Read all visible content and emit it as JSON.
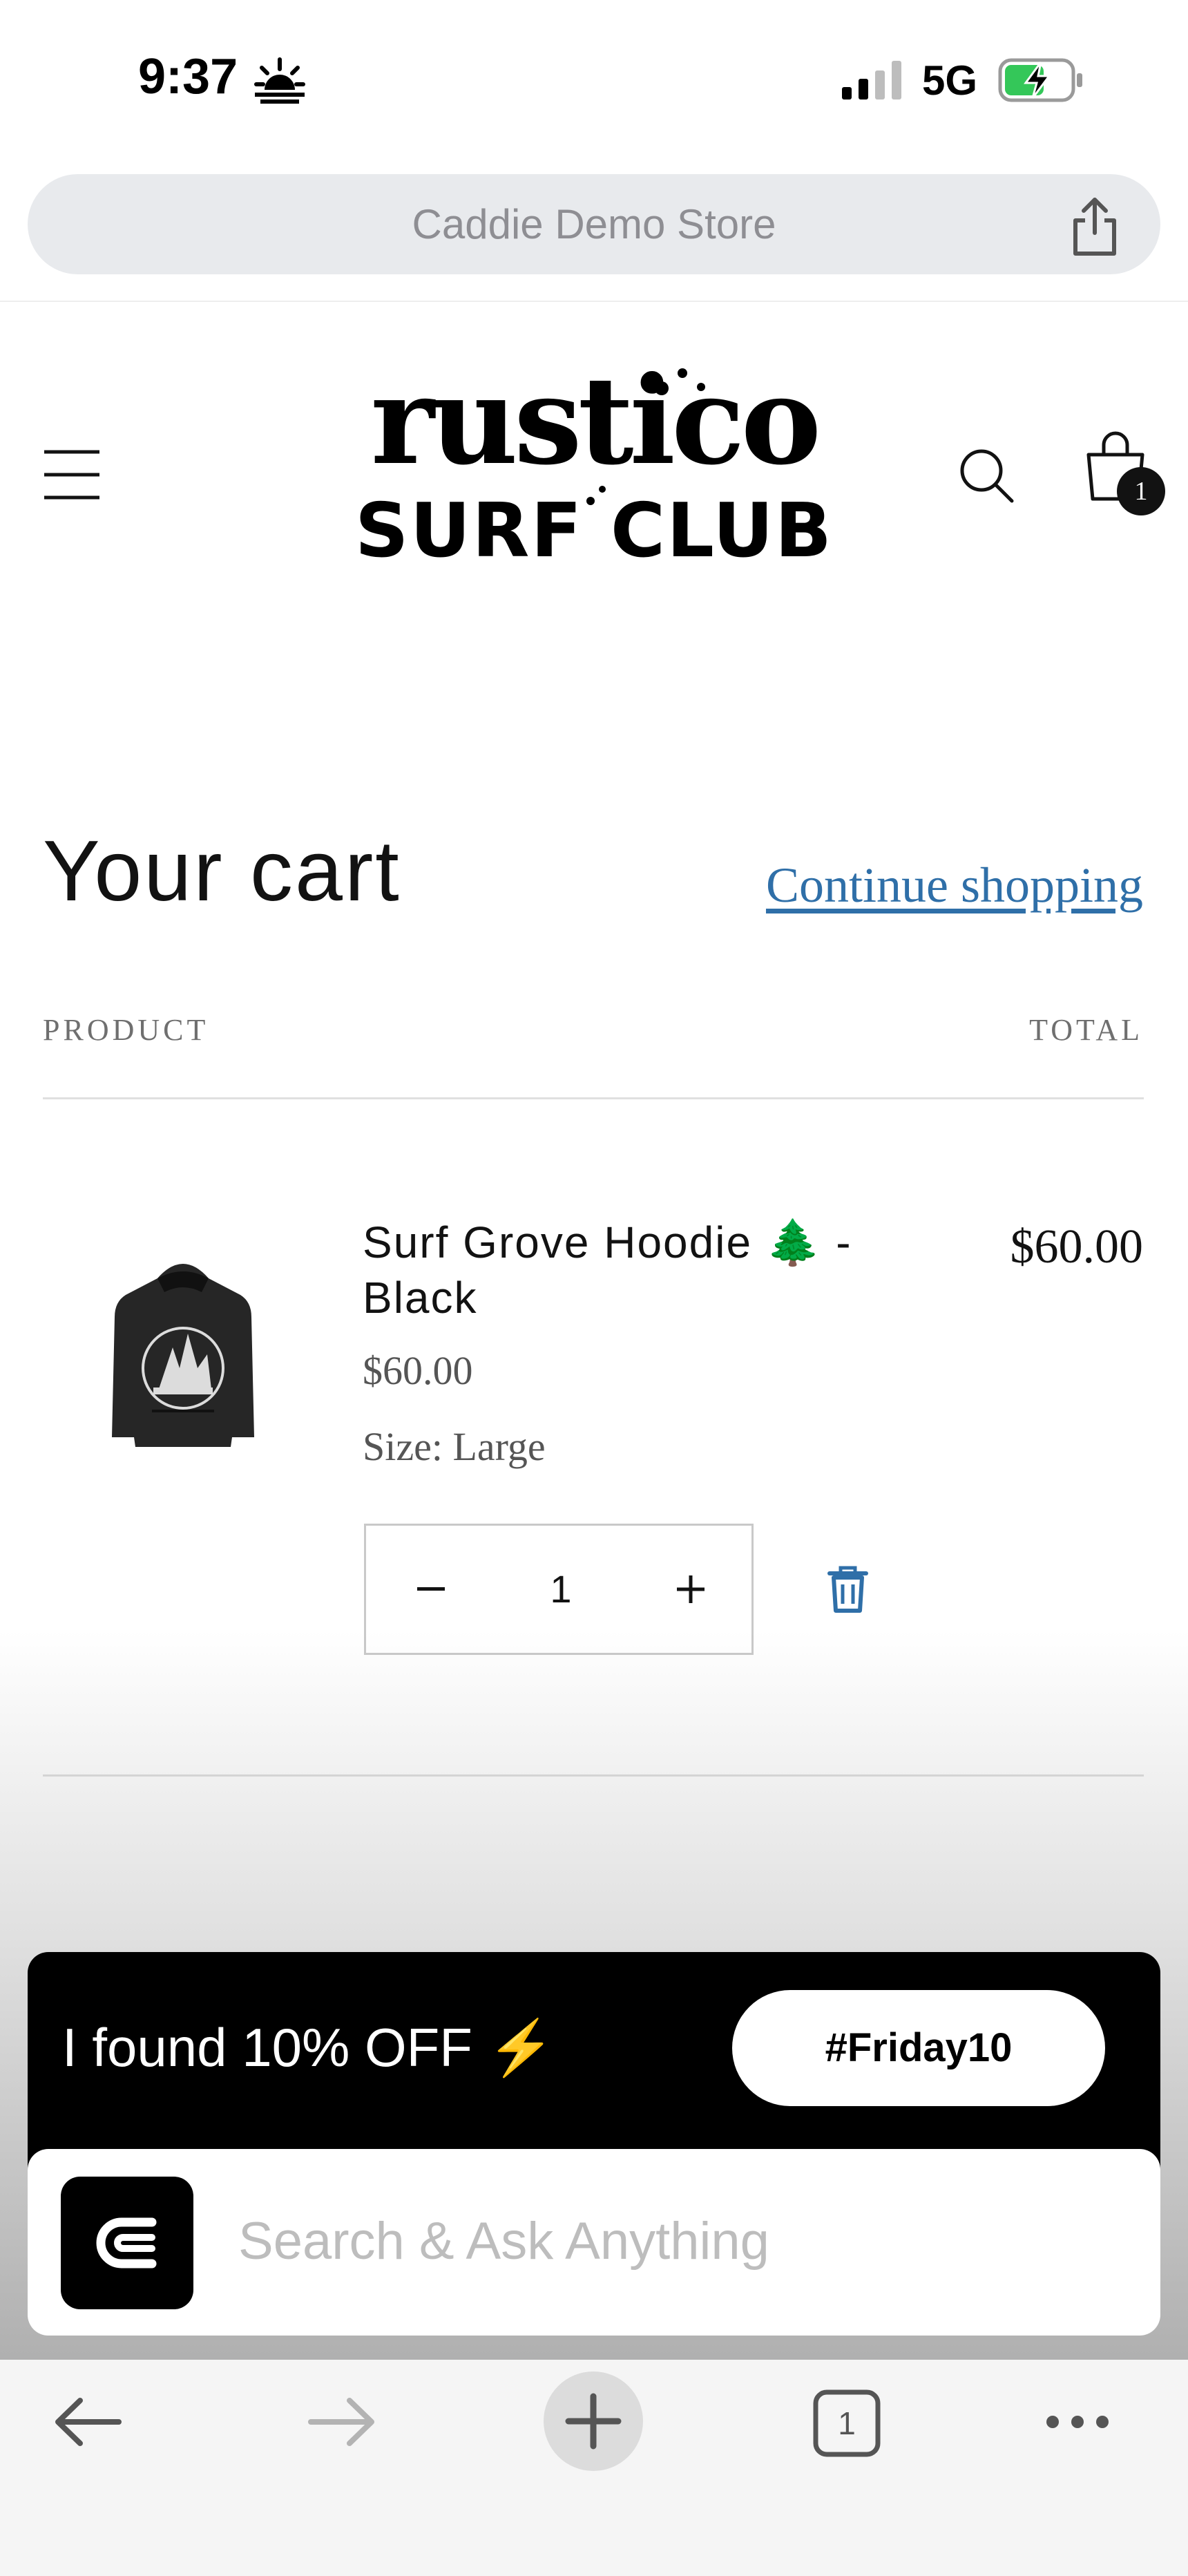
{
  "status_bar": {
    "time": "9:37",
    "network": "5G",
    "sun_icon": "sunrise-icon",
    "signal_icon": "cellular-signal-icon",
    "battery_icon": "battery-charging-icon"
  },
  "browser": {
    "site_title": "Caddie Demo Store",
    "share_icon": "share-icon"
  },
  "header": {
    "logo_alt": "rustico SURF CLUB",
    "cart_count": "1"
  },
  "cart": {
    "title": "Your cart",
    "continue_label": "Continue shopping",
    "col_product": "PRODUCT",
    "col_total": "TOTAL",
    "item": {
      "name": "Surf Grove Hoodie 🌲 - Black",
      "price": "$60.00",
      "size": "Size: Large",
      "quantity": "1",
      "line_total": "$60.00"
    }
  },
  "promo": {
    "message": "I found 10% OFF ⚡",
    "code": "#Friday10"
  },
  "ask": {
    "placeholder": "Search & Ask Anything"
  },
  "toolbar": {
    "tab_count": "1"
  },
  "colors": {
    "link": "#2f6fa8",
    "promo_bg": "#000000",
    "trash": "#2f6fa8"
  }
}
